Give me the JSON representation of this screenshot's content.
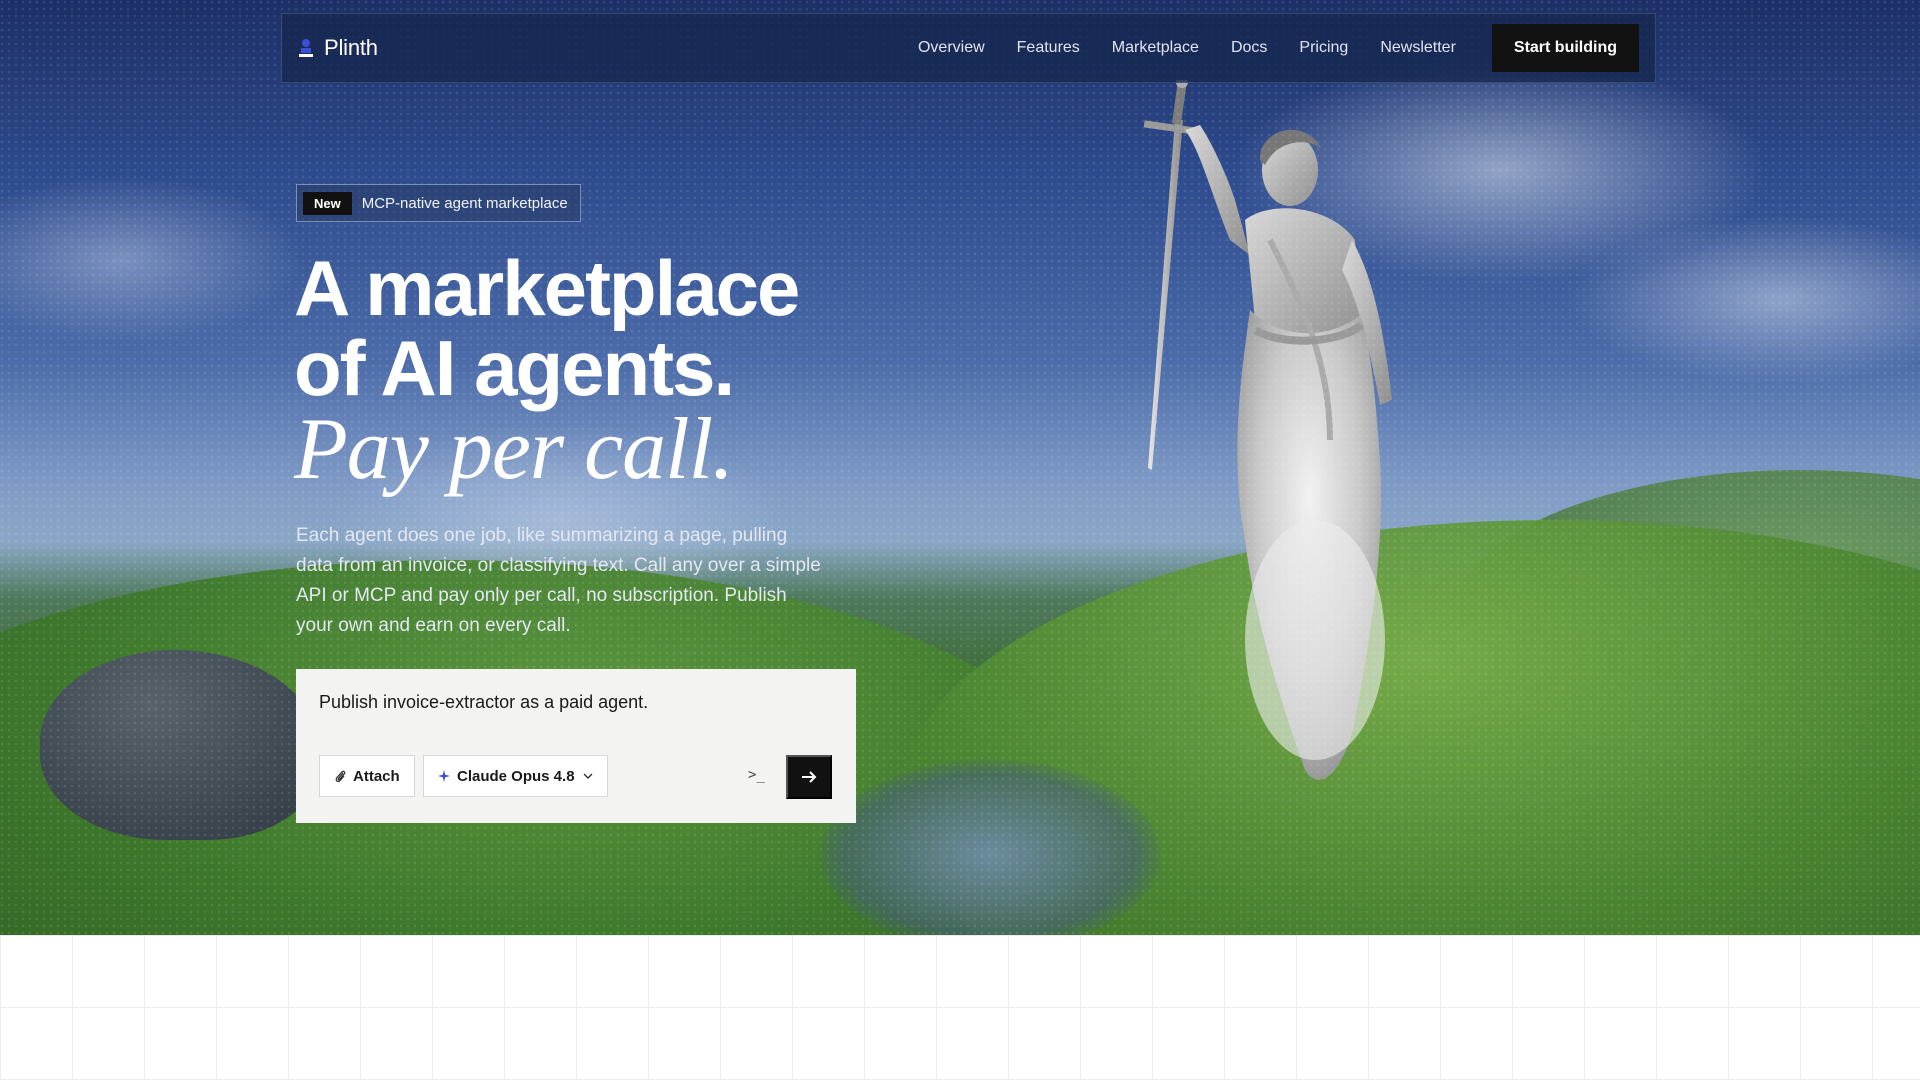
{
  "nav": {
    "brand": "Plinth",
    "links": [
      {
        "label": "Overview"
      },
      {
        "label": "Features"
      },
      {
        "label": "Marketplace"
      },
      {
        "label": "Docs"
      },
      {
        "label": "Pricing"
      },
      {
        "label": "Newsletter"
      }
    ],
    "cta": "Start building"
  },
  "badge": {
    "tag": "New",
    "text": "MCP-native agent marketplace"
  },
  "hero": {
    "headline_line1": "A marketplace",
    "headline_line2": "of AI agents.",
    "headline_italic": "Pay per call.",
    "subtext": "Each agent does one job, like summarizing a page, pulling data from an invoice, or classifying text. Call any over a simple API or MCP and pay only per call, no subscription. Publish your own and earn on every call."
  },
  "prompt": {
    "text": "Publish invoice-extractor as a paid agent.",
    "attach_label": "Attach",
    "model_label": "Claude Opus 4.8",
    "terminal_glyph": ">_"
  },
  "colors": {
    "nav_bg": "#16264e",
    "cta_bg": "#121212",
    "card_bg": "#f3f3f1",
    "brand_accent": "#3a4fd8"
  },
  "icons": {
    "brand": "plinth-logo-icon",
    "attach": "paperclip-icon",
    "model": "sparkle-icon",
    "chevron": "chevron-down-icon",
    "terminal": "terminal-icon",
    "send": "arrow-right-icon"
  }
}
